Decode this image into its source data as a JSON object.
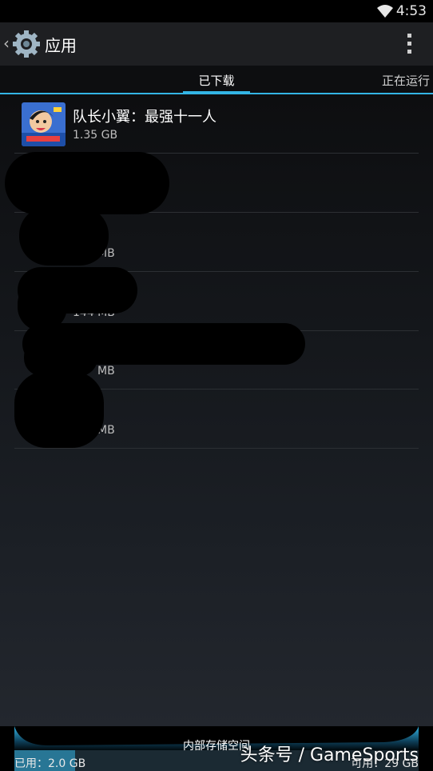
{
  "status_bar": {
    "time": "4:53"
  },
  "action_bar": {
    "title": "应用"
  },
  "tabs": [
    {
      "label": "已下载",
      "selected": true
    },
    {
      "label": "正在运行",
      "selected": false
    }
  ],
  "apps": [
    {
      "name": "队长小翼：最强十一人",
      "size": "1.35 GB"
    },
    {
      "name": "",
      "size": ""
    },
    {
      "name": "",
      "size": "MB"
    },
    {
      "name": "",
      "size": "144 MB"
    },
    {
      "name": "",
      "size": "MB"
    },
    {
      "name": "",
      "size": "MB"
    }
  ],
  "storage": {
    "label": "内部存储空间",
    "used": "已用：2.0 GB",
    "free": "可用：29 GB"
  },
  "watermark": "头条号 / GameSports",
  "colors": {
    "accent": "#33b5e5",
    "background": "#000000"
  }
}
